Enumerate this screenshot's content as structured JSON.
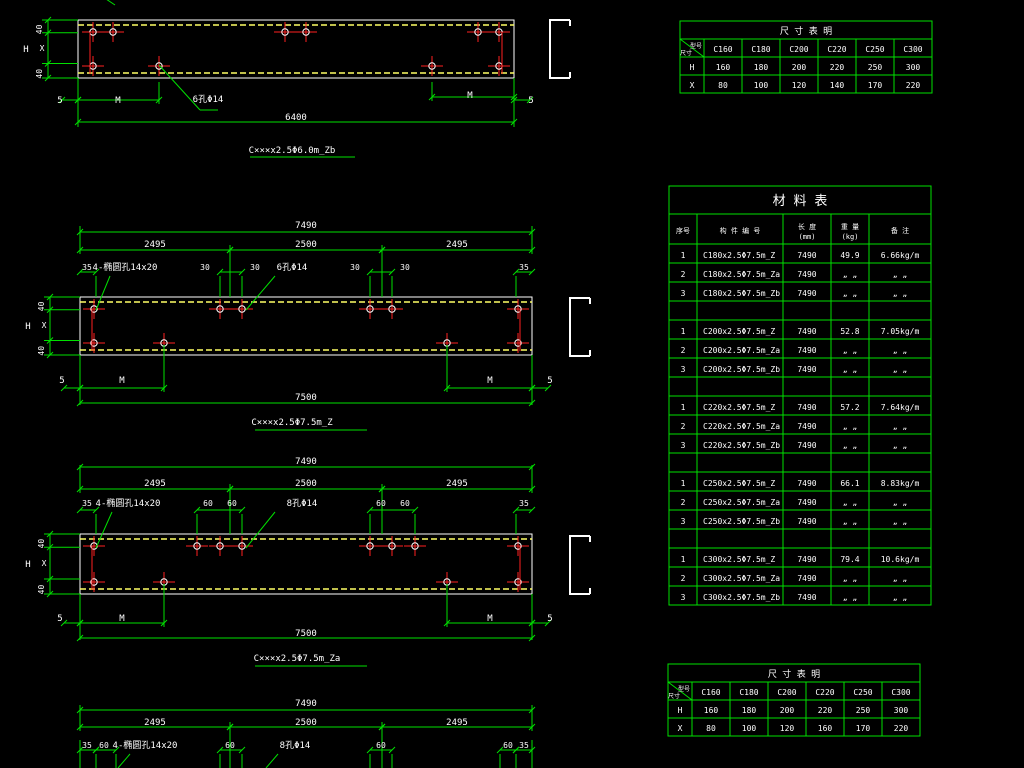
{
  "colors": {
    "green": "#00e000",
    "white": "#ffffff",
    "red": "#ff2020",
    "yellow": "#ffff66",
    "cyan": "#00ffff"
  },
  "beam1": {
    "dim_H": "H",
    "dim_40a": "40",
    "dim_X": "X",
    "dim_40b": "40",
    "left_5": "5",
    "right_5": "5",
    "m_left": "M",
    "m_right": "M",
    "hole_note": "6孔Φ14",
    "total": "6400",
    "caption": "C×××x2.5Φ6.0m_Zb"
  },
  "beam2": {
    "top_total": "7490",
    "seg_a": "2495",
    "seg_b": "2500",
    "seg_c": "2495",
    "d35a": "35",
    "slot_note": "4-椭圆孔14x20",
    "d30a": "30",
    "d30b": "30",
    "hole_note": "6孔Φ14",
    "d30c": "30",
    "d30d": "30",
    "d35b": "35",
    "dim_H": "H",
    "dim_40a": "40",
    "dim_X": "X",
    "dim_40b": "40",
    "left_5": "5",
    "right_5": "5",
    "m_left": "M",
    "m_right": "M",
    "bottom_total": "7500",
    "caption": "C×××x2.5Φ7.5m_Z"
  },
  "beam3": {
    "top_total": "7490",
    "seg_a": "2495",
    "seg_b": "2500",
    "seg_c": "2495",
    "d35a": "35",
    "slot_note": "4-椭圆孔14x20",
    "d60a": "60",
    "d60b": "60",
    "hole_note": "8孔Φ14",
    "d60c": "60",
    "d60d": "60",
    "d35b": "35",
    "dim_H": "H",
    "dim_40a": "40",
    "dim_X": "X",
    "dim_40b": "40",
    "left_5": "5",
    "right_5": "5",
    "m_left": "M",
    "m_right": "M",
    "bottom_total": "7500",
    "caption": "C×××x2.5Φ7.5m_Za"
  },
  "beam4": {
    "top_total": "7490",
    "seg_a": "2495",
    "seg_b": "2500",
    "seg_c": "2495",
    "d35a": "35",
    "d60a": "60",
    "slot_note": "4-椭圆孔14x20",
    "d60b": "60",
    "hole_note": "8孔Φ14",
    "d60c": "60",
    "d60d": "60",
    "d35b": "35"
  },
  "size_table_top": {
    "title": "尺 寸 表 明",
    "corner_top": "型号",
    "corner_bottom": "尺寸",
    "columns": [
      "C160",
      "C180",
      "C200",
      "C220",
      "C250",
      "C300"
    ],
    "rows": [
      {
        "label": "H",
        "values": [
          "160",
          "180",
          "200",
          "220",
          "250",
          "300"
        ]
      },
      {
        "label": "X",
        "values": [
          "80",
          "100",
          "120",
          "140",
          "170",
          "220"
        ]
      }
    ]
  },
  "material_table": {
    "title": "材    料    表",
    "headers": [
      "序号",
      "构 件 编 号",
      "长 度\n(mm)",
      "重 量\n(kg)",
      "备 注"
    ],
    "groups": [
      {
        "rows": [
          [
            "1",
            "C180x2.5Φ7.5m_Z",
            "7490",
            "49.9",
            "6.66kg/m"
          ],
          [
            "2",
            "C180x2.5Φ7.5m_Za",
            "7490",
            "„ „",
            "„ „"
          ],
          [
            "3",
            "C180x2.5Φ7.5m_Zb",
            "7490",
            "„ „",
            "„ „"
          ]
        ]
      },
      {
        "rows": [
          [
            "1",
            "C200x2.5Φ7.5m_Z",
            "7490",
            "52.8",
            "7.05kg/m"
          ],
          [
            "2",
            "C200x2.5Φ7.5m_Za",
            "7490",
            "„ „",
            "„ „"
          ],
          [
            "3",
            "C200x2.5Φ7.5m_Zb",
            "7490",
            "„ „",
            "„ „"
          ]
        ]
      },
      {
        "rows": [
          [
            "1",
            "C220x2.5Φ7.5m_Z",
            "7490",
            "57.2",
            "7.64kg/m"
          ],
          [
            "2",
            "C220x2.5Φ7.5m_Za",
            "7490",
            "„ „",
            "„ „"
          ],
          [
            "3",
            "C220x2.5Φ7.5m_Zb",
            "7490",
            "„ „",
            "„ „"
          ]
        ]
      },
      {
        "rows": [
          [
            "1",
            "C250x2.5Φ7.5m_Z",
            "7490",
            "66.1",
            "8.83kg/m"
          ],
          [
            "2",
            "C250x2.5Φ7.5m_Za",
            "7490",
            "„ „",
            "„ „"
          ],
          [
            "3",
            "C250x2.5Φ7.5m_Zb",
            "7490",
            "„ „",
            "„ „"
          ]
        ]
      },
      {
        "rows": [
          [
            "1",
            "C300x2.5Φ7.5m_Z",
            "7490",
            "79.4",
            "10.6kg/m"
          ],
          [
            "2",
            "C300x2.5Φ7.5m_Za",
            "7490",
            "„ „",
            "„ „"
          ],
          [
            "3",
            "C300x2.5Φ7.5m_Zb",
            "7490",
            "„ „",
            "„ „"
          ]
        ]
      }
    ]
  },
  "size_table_bottom": {
    "title": "尺 寸 表 明",
    "corner_top": "型号",
    "corner_bottom": "尺寸",
    "columns": [
      "C160",
      "C180",
      "C200",
      "C220",
      "C250",
      "C300"
    ],
    "rows": [
      {
        "label": "H",
        "values": [
          "160",
          "180",
          "200",
          "220",
          "250",
          "300"
        ]
      },
      {
        "label": "X",
        "values": [
          "80",
          "100",
          "120",
          "160",
          "170",
          "220"
        ]
      }
    ]
  }
}
